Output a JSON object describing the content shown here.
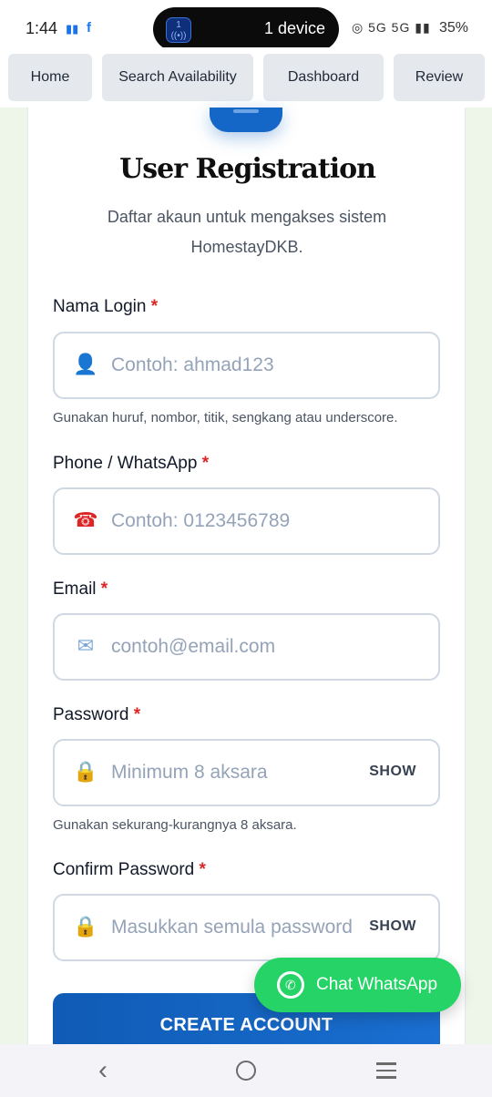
{
  "status_bar": {
    "time": "1:44",
    "device_label": "1 device",
    "device_badge": "1",
    "network": "5G 5G",
    "battery": "35%"
  },
  "nav": {
    "items": [
      {
        "label": "Home"
      },
      {
        "label": "Search Availability"
      },
      {
        "label": "Dashboard"
      },
      {
        "label": "Review"
      }
    ]
  },
  "form": {
    "title": "User Registration",
    "subtitle": "Daftar akaun untuk mengakses sistem HomestayDKB.",
    "required_mark": "*",
    "fields": {
      "login": {
        "label": "Nama Login",
        "placeholder": "Contoh: ahmad123",
        "value": "",
        "icon": "user-icon",
        "hint": "Gunakan huruf, nombor, titik, sengkang atau underscore."
      },
      "phone": {
        "label": "Phone / WhatsApp",
        "placeholder": "Contoh: 0123456789",
        "value": "",
        "icon": "phone-icon"
      },
      "email": {
        "label": "Email",
        "placeholder": "contoh@email.com",
        "value": "",
        "icon": "mail-icon"
      },
      "password": {
        "label": "Password",
        "placeholder": "Minimum 8 aksara",
        "value": "",
        "icon": "lock-icon",
        "toggle": "SHOW",
        "hint": "Gunakan sekurang-kurangnya 8 aksara."
      },
      "confirm": {
        "label": "Confirm Password",
        "placeholder": "Masukkan semula password",
        "value": "",
        "icon": "lock-icon",
        "toggle": "SHOW"
      }
    },
    "submit_label": "CREATE ACCOUNT"
  },
  "whatsapp": {
    "label": "Chat WhatsApp",
    "color": "#25d366"
  },
  "colors": {
    "primary": "#1466c7",
    "required": "#dc2626"
  }
}
